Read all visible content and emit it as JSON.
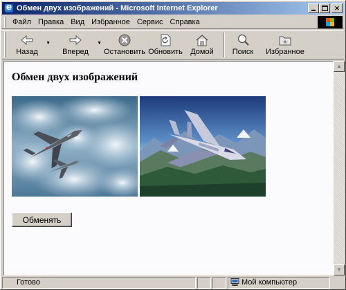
{
  "window": {
    "title": "Обмен двух изображений - Microsoft Internet Explorer"
  },
  "menu": {
    "items": [
      {
        "label": "Файл"
      },
      {
        "label": "Правка"
      },
      {
        "label": "Вид"
      },
      {
        "label": "Избранное"
      },
      {
        "label": "Сервис"
      },
      {
        "label": "Справка"
      }
    ]
  },
  "toolbar": {
    "back": "Назад",
    "forward": "Вперед",
    "stop": "Остановить",
    "refresh": "Обновить",
    "home": "Домой",
    "search": "Поиск",
    "favorites": "Избранное"
  },
  "page": {
    "heading": "Обмен двух изображений",
    "swap_button": "Обменять"
  },
  "status": {
    "text": "Готово",
    "zone": "Мой компьютер"
  },
  "colors": {
    "title_bar_start": "#0a246a",
    "title_bar_end": "#a6caf0",
    "chrome": "#d4d0c8",
    "page_background": "#fbfbfd"
  }
}
